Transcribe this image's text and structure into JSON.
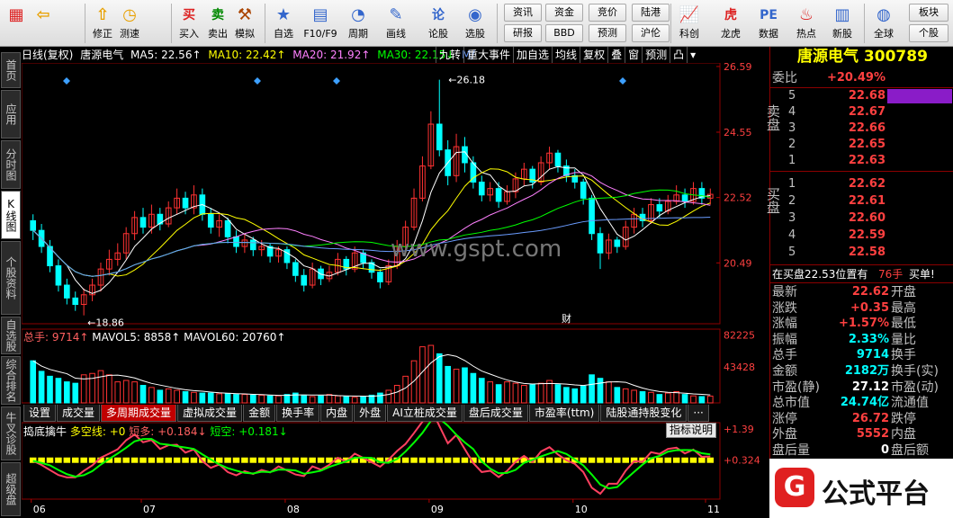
{
  "toolbar": {
    "buttons": [
      {
        "label": "",
        "icon": "grid-icon",
        "glyph": "▦"
      },
      {
        "label": "",
        "icon": "back-arrow-icon",
        "glyph": "⇦"
      },
      {
        "label": "修正",
        "icon": "revise-icon",
        "glyph": "⇧"
      },
      {
        "label": "测速",
        "icon": "speed-icon",
        "glyph": "◷"
      },
      {
        "label": "买入",
        "icon": "buy-icon",
        "glyph": "买"
      },
      {
        "label": "卖出",
        "icon": "sell-icon",
        "glyph": "卖"
      },
      {
        "label": "模拟",
        "icon": "hammer-icon",
        "glyph": "⚒"
      },
      {
        "label": "自选",
        "icon": "star-icon",
        "glyph": "★"
      },
      {
        "label": "F10/F9",
        "icon": "f10-icon",
        "glyph": "▤"
      },
      {
        "label": "周期",
        "icon": "cycle-icon",
        "glyph": "◔"
      },
      {
        "label": "画线",
        "icon": "pencil-icon",
        "glyph": "✎"
      },
      {
        "label": "论股",
        "icon": "discuss-icon",
        "glyph": "论"
      },
      {
        "label": "选股",
        "icon": "select-stock-icon",
        "glyph": "◉"
      },
      {
        "label": "科创",
        "icon": "kechuang-icon",
        "glyph": "📈"
      },
      {
        "label": "龙虎",
        "icon": "dragon-icon",
        "glyph": "虎"
      },
      {
        "label": "数据",
        "icon": "pe-icon",
        "glyph": "PE"
      },
      {
        "label": "热点",
        "icon": "hot-icon",
        "glyph": "♨"
      },
      {
        "label": "新股",
        "icon": "ipo-icon",
        "glyph": "▥"
      },
      {
        "label": "全球",
        "icon": "globe-icon",
        "glyph": "◍"
      }
    ],
    "small_buttons": [
      "资讯",
      "资金",
      "竞价",
      "陆港",
      "研报",
      "BBD",
      "预测",
      "沪伦"
    ],
    "right_buttons": [
      "板块",
      "个股"
    ]
  },
  "leftnav": {
    "tabs": [
      {
        "label": "首页",
        "active": false
      },
      {
        "label": "应用",
        "active": false
      },
      {
        "label": "分时图",
        "active": false
      },
      {
        "label": "K线图",
        "active": true
      },
      {
        "label": "个股资料",
        "active": false
      },
      {
        "label": "自选股",
        "active": false
      },
      {
        "label": "综合排名",
        "active": false
      },
      {
        "label": "牛叉诊股",
        "active": false
      },
      {
        "label": "超级盘",
        "active": false
      }
    ]
  },
  "chart_header": {
    "period": "日线(复权)",
    "stock": "唐源电气",
    "ma5": "MA5: 22.56↑",
    "ma10": "MA10: 22.42↑",
    "ma20": "MA20: 21.92↑",
    "ma30": "MA30: 22.15↓",
    "more": "M/",
    "tools": [
      "九转",
      "重大事件",
      "加自选",
      "均线",
      "复权",
      "叠",
      "窗",
      "预测",
      "凸",
      "▾"
    ]
  },
  "colors": {
    "up": "#ff3232",
    "down": "#00ffff",
    "ma5": "#ffffff",
    "ma10": "#ffff00",
    "ma20": "#ff80ff",
    "ma30": "#00ff00",
    "ma60": "#6a9cff"
  },
  "chart_data": [
    {
      "type": "candlestick",
      "title": "唐源电气 日线(复权)",
      "yticks": [
        "26.59",
        "24.55",
        "22.52",
        "20.49"
      ],
      "ylim": [
        18.6,
        26.7
      ],
      "xticks": [
        "06",
        "07",
        "08",
        "09",
        "10",
        "11"
      ],
      "annotations": [
        "26.18",
        "18.86",
        "财"
      ],
      "candles": [
        [
          21.8,
          21.5,
          22.0,
          21.2
        ],
        [
          21.5,
          21.0,
          21.7,
          20.8
        ],
        [
          21.0,
          20.4,
          21.2,
          20.2
        ],
        [
          20.4,
          19.8,
          20.6,
          19.6
        ],
        [
          19.8,
          19.4,
          20.0,
          19.2
        ],
        [
          19.4,
          19.2,
          19.6,
          19.0
        ],
        [
          19.2,
          19.5,
          19.7,
          18.86
        ],
        [
          19.5,
          19.8,
          20.0,
          19.3
        ],
        [
          19.8,
          20.3,
          20.5,
          19.6
        ],
        [
          20.3,
          20.6,
          20.9,
          20.1
        ],
        [
          20.6,
          20.8,
          21.1,
          20.4
        ],
        [
          20.8,
          21.4,
          21.6,
          20.6
        ],
        [
          21.4,
          21.9,
          22.1,
          21.2
        ],
        [
          21.9,
          21.6,
          22.2,
          21.4
        ],
        [
          21.6,
          22.0,
          22.3,
          21.4
        ],
        [
          22.0,
          21.7,
          22.2,
          21.5
        ],
        [
          21.7,
          22.2,
          22.4,
          21.6
        ],
        [
          22.2,
          22.5,
          22.8,
          22.0
        ],
        [
          22.5,
          22.2,
          22.7,
          22.0
        ],
        [
          22.2,
          22.6,
          22.9,
          22.0
        ],
        [
          22.6,
          22.0,
          22.8,
          21.8
        ],
        [
          22.0,
          21.6,
          22.2,
          21.4
        ],
        [
          21.6,
          21.8,
          22.0,
          21.3
        ],
        [
          21.8,
          21.3,
          21.9,
          21.1
        ],
        [
          21.3,
          21.0,
          21.5,
          20.8
        ],
        [
          21.0,
          21.2,
          21.4,
          20.8
        ],
        [
          21.2,
          20.9,
          21.3,
          20.7
        ],
        [
          20.9,
          21.0,
          21.2,
          20.7
        ],
        [
          21.0,
          20.7,
          21.1,
          20.5
        ],
        [
          20.7,
          20.9,
          21.0,
          20.5
        ],
        [
          20.9,
          20.5,
          21.0,
          20.3
        ],
        [
          20.5,
          20.1,
          20.6,
          19.9
        ],
        [
          20.1,
          19.8,
          20.3,
          19.6
        ],
        [
          19.8,
          20.3,
          20.5,
          19.7
        ],
        [
          20.3,
          20.0,
          20.4,
          19.8
        ],
        [
          20.0,
          20.2,
          20.4,
          19.9
        ],
        [
          20.2,
          20.6,
          20.8,
          20.1
        ],
        [
          20.6,
          20.3,
          20.7,
          20.1
        ],
        [
          20.3,
          20.8,
          21.0,
          20.2
        ],
        [
          20.8,
          20.5,
          20.9,
          20.3
        ],
        [
          20.5,
          20.2,
          20.6,
          20.0
        ],
        [
          20.2,
          19.9,
          20.3,
          19.7
        ],
        [
          19.9,
          20.4,
          20.6,
          19.8
        ],
        [
          20.4,
          21.0,
          21.2,
          20.3
        ],
        [
          21.0,
          21.6,
          21.8,
          20.9
        ],
        [
          21.6,
          22.5,
          22.8,
          21.5
        ],
        [
          22.5,
          23.5,
          23.8,
          22.4
        ],
        [
          23.5,
          24.8,
          25.2,
          23.4
        ],
        [
          24.8,
          24.0,
          26.18,
          23.8
        ],
        [
          24.0,
          23.2,
          24.3,
          22.9
        ],
        [
          23.2,
          24.1,
          24.5,
          23.0
        ],
        [
          24.1,
          23.6,
          24.4,
          23.3
        ],
        [
          23.6,
          23.0,
          23.8,
          22.8
        ],
        [
          23.0,
          22.6,
          23.2,
          22.4
        ],
        [
          22.6,
          22.8,
          23.0,
          22.4
        ],
        [
          22.8,
          22.4,
          23.0,
          22.2
        ],
        [
          22.4,
          22.7,
          22.9,
          22.3
        ],
        [
          22.7,
          23.1,
          23.3,
          22.5
        ],
        [
          23.1,
          23.4,
          23.6,
          22.9
        ],
        [
          23.4,
          23.0,
          23.5,
          22.8
        ],
        [
          23.0,
          23.6,
          23.8,
          22.9
        ],
        [
          23.6,
          23.9,
          24.1,
          23.4
        ],
        [
          23.9,
          23.5,
          24.0,
          23.3
        ],
        [
          23.5,
          23.2,
          23.7,
          23.0
        ],
        [
          23.2,
          23.0,
          23.4,
          22.8
        ],
        [
          23.0,
          22.5,
          23.1,
          22.3
        ],
        [
          22.5,
          21.4,
          22.6,
          21.2
        ],
        [
          21.4,
          20.8,
          21.6,
          20.3
        ],
        [
          20.8,
          21.2,
          21.4,
          20.6
        ],
        [
          21.2,
          21.0,
          21.3,
          20.8
        ],
        [
          21.0,
          21.6,
          21.8,
          20.9
        ],
        [
          21.6,
          22.0,
          22.2,
          21.4
        ],
        [
          22.0,
          21.8,
          22.2,
          21.6
        ],
        [
          21.8,
          22.3,
          22.5,
          21.7
        ],
        [
          22.3,
          22.1,
          22.5,
          21.9
        ],
        [
          22.1,
          22.4,
          22.6,
          22.0
        ],
        [
          22.4,
          22.6,
          22.9,
          22.3
        ],
        [
          22.6,
          22.4,
          22.8,
          22.2
        ],
        [
          22.4,
          22.8,
          23.0,
          22.3
        ],
        [
          22.8,
          22.5,
          23.0,
          22.3
        ],
        [
          22.5,
          22.62,
          22.8,
          22.3
        ]
      ]
    },
    {
      "type": "bar",
      "title": "总手",
      "legend": [
        "总手: 9714↑",
        "MAVOL5: 8858↑",
        "MAVOL60: 20760↑"
      ],
      "yticks": [
        "82225",
        "43428"
      ],
      "ylim": [
        0,
        85000
      ],
      "values": [
        60,
        45,
        38,
        35,
        30,
        28,
        40,
        42,
        46,
        40,
        30,
        32,
        30,
        25,
        22,
        18,
        20,
        18,
        16,
        15,
        14,
        14,
        13,
        13,
        12,
        12,
        11,
        11,
        10,
        10,
        12,
        14,
        11,
        9,
        10,
        12,
        10,
        9,
        8,
        9,
        11,
        14,
        18,
        25,
        38,
        60,
        80,
        82,
        70,
        52,
        48,
        50,
        42,
        35,
        30,
        26,
        30,
        28,
        25,
        26,
        28,
        32,
        26,
        22,
        20,
        24,
        40,
        35,
        30,
        22,
        20,
        18,
        16,
        15,
        12,
        14,
        16,
        12,
        10,
        9,
        9.7
      ]
    },
    {
      "type": "line",
      "title": "捣底擒牛",
      "legend": [
        "多空线: +0",
        "短多: +0.184↓",
        "短空: +0.181↓"
      ],
      "yticks": [
        "+1.39",
        "+0.324"
      ],
      "ylim": [
        -1.0,
        1.6
      ]
    }
  ],
  "bottom_tabs": [
    "设置",
    "成交量",
    "多周期成交量",
    "虚拟成交量",
    "金额",
    "换手率",
    "内盘",
    "外盘",
    "AI立桩成交量",
    "盘后成交量",
    "市盈率(ttm)",
    "陆股通持股变化",
    "···"
  ],
  "indicator_help": "指标说明",
  "right_panel": {
    "name": "唐源电气",
    "code": "300789",
    "weibi_label": "委比",
    "weibi": "+20.49%",
    "sell_label": "卖盘",
    "buy_label": "买盘",
    "sells": [
      {
        "n": "5",
        "price": "22.68"
      },
      {
        "n": "4",
        "price": "22.67"
      },
      {
        "n": "3",
        "price": "22.66"
      },
      {
        "n": "2",
        "price": "22.65"
      },
      {
        "n": "1",
        "price": "22.63"
      }
    ],
    "buys": [
      {
        "n": "1",
        "price": "22.62"
      },
      {
        "n": "2",
        "price": "22.61"
      },
      {
        "n": "3",
        "price": "22.60"
      },
      {
        "n": "4",
        "price": "22.59"
      },
      {
        "n": "5",
        "price": "22.58"
      }
    ],
    "tick_text": "在买盘22.53位置有",
    "tick_vol": "76手",
    "tick_action": "买单!",
    "stats": [
      {
        "l": "最新",
        "v": "22.62",
        "c": "red",
        "l2": "开盘",
        "v2": "",
        "c2": "red"
      },
      {
        "l": "涨跌",
        "v": "+0.35",
        "c": "red",
        "l2": "最高",
        "v2": "",
        "c2": "red"
      },
      {
        "l": "涨幅",
        "v": "+1.57%",
        "c": "red",
        "l2": "最低",
        "v2": "",
        "c2": "red"
      },
      {
        "l": "振幅",
        "v": "2.33%",
        "c": "cyan",
        "l2": "量比",
        "v2": "",
        "c2": "yel"
      },
      {
        "l": "总手",
        "v": "9714",
        "c": "cyan",
        "l2": "换手",
        "v2": "",
        "c2": "yel"
      },
      {
        "l": "金额",
        "v": "2182万",
        "c": "cyan",
        "l2": "换手(实)",
        "v2": "",
        "c2": "yel"
      },
      {
        "l": "市盈(静)",
        "v": "27.12",
        "c": "wht",
        "l2": "市盈(动)",
        "v2": "",
        "c2": "wht"
      },
      {
        "l": "总市值",
        "v": "24.74亿",
        "c": "cyan",
        "l2": "流通值",
        "v2": "",
        "c2": "cyan"
      },
      {
        "l": "涨停",
        "v": "26.72",
        "c": "red",
        "l2": "跌停",
        "v2": "",
        "c2": "grn"
      },
      {
        "l": "外盘",
        "v": "5552",
        "c": "red",
        "l2": "内盘",
        "v2": "",
        "c2": "grn"
      },
      {
        "l": "盘后量",
        "v": "0",
        "c": "wht",
        "l2": "盘后额",
        "v2": "",
        "c2": "wht"
      }
    ]
  },
  "brand": {
    "text": "公式平台",
    "mark": "G"
  }
}
